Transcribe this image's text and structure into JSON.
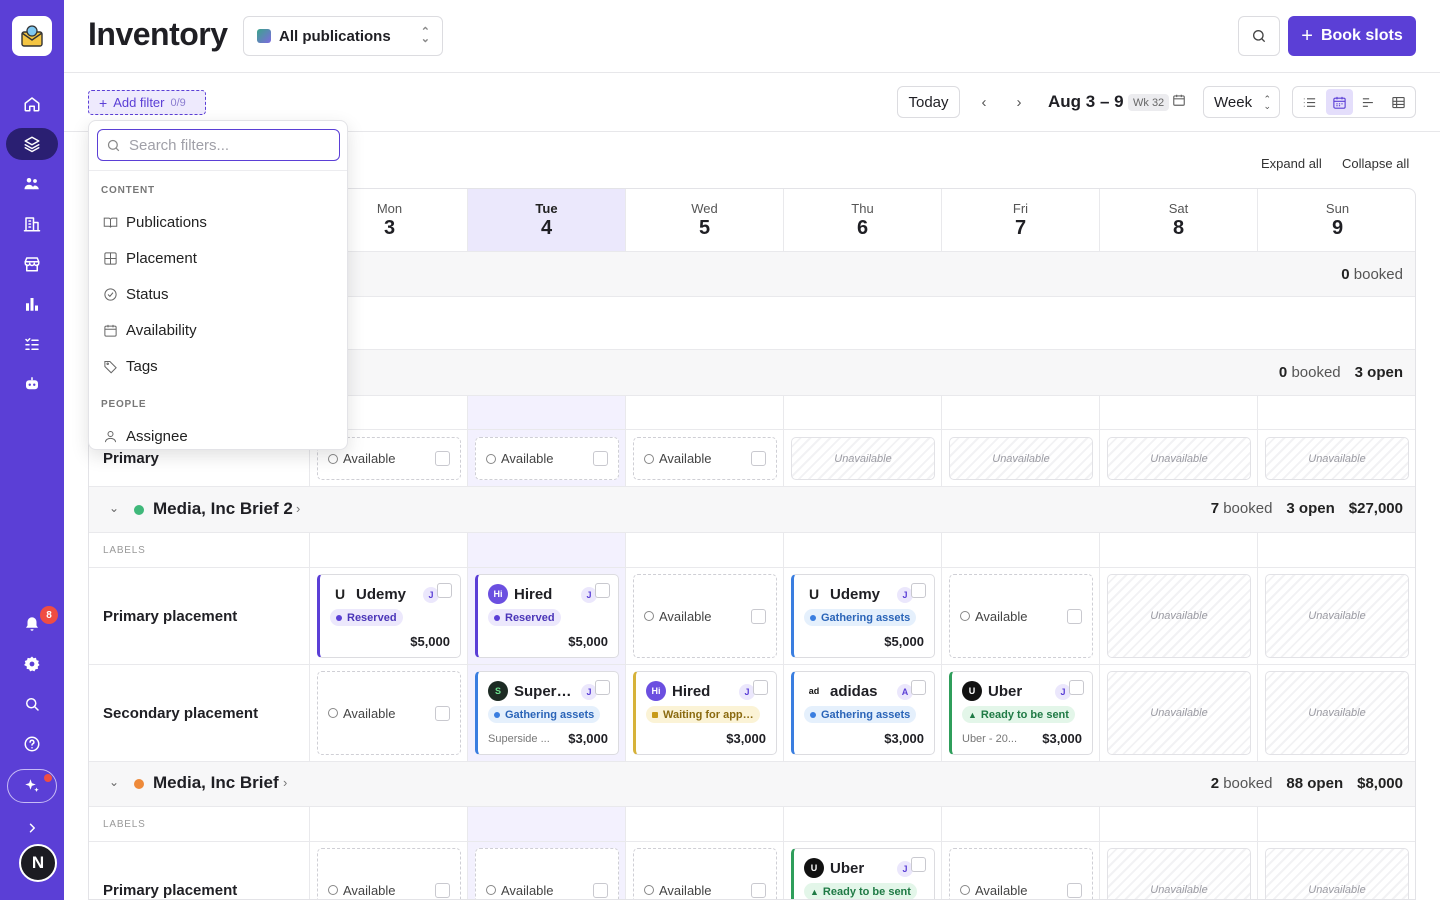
{
  "app": {
    "title": "Inventory",
    "book_label": "Book slots"
  },
  "publication_select": {
    "value": "All publications"
  },
  "toolbar": {
    "add_filter_label": "Add filter",
    "filter_count": "0/9",
    "today_label": "Today",
    "date_range": "Aug 3 – 9",
    "week_badge": "Wk 32",
    "view_mode": "Week",
    "expand_all": "Expand all",
    "collapse_all": "Collapse all"
  },
  "sidebar": {
    "notification_count": "8",
    "avatar_initial": "N",
    "items": [
      "home-icon",
      "layers-icon",
      "audience-icon",
      "buildings-icon",
      "store-icon",
      "chart-icon",
      "tasks-icon",
      "bot-icon"
    ],
    "bottom": [
      "bell-icon",
      "gear-icon",
      "search-icon",
      "help-icon",
      "sparkle-icon",
      "expand-icon"
    ]
  },
  "days": [
    {
      "name": "Mon",
      "date": "3"
    },
    {
      "name": "Tue",
      "date": "4",
      "today": true
    },
    {
      "name": "Wed",
      "date": "5"
    },
    {
      "name": "Thu",
      "date": "6"
    },
    {
      "name": "Fri",
      "date": "7"
    },
    {
      "name": "Sat",
      "date": "8"
    },
    {
      "name": "Sun",
      "date": "9"
    }
  ],
  "filter_popover": {
    "search_placeholder": "Search filters...",
    "sections": [
      {
        "title": "CONTENT",
        "items": [
          {
            "label": "Publications",
            "icon": "book-icon"
          },
          {
            "label": "Placement",
            "icon": "grid-icon"
          },
          {
            "label": "Status",
            "icon": "check-circle-icon"
          },
          {
            "label": "Availability",
            "icon": "calendar-icon"
          },
          {
            "label": "Tags",
            "icon": "tag-icon"
          }
        ]
      },
      {
        "title": "PEOPLE",
        "items": [
          {
            "label": "Assignee",
            "icon": "person-icon"
          }
        ]
      }
    ]
  },
  "group0": {
    "booked_count": "0",
    "booked_word": "booked"
  },
  "group1": {
    "booked_count": "0",
    "booked_word": "booked",
    "open": "3 open",
    "row_label": "Primary"
  },
  "group2": {
    "name": "Media, Inc Brief 2",
    "booked_count": "7",
    "booked_word": "booked",
    "open": "3 open",
    "total": "$27,000",
    "color": "#3fb87a"
  },
  "group3": {
    "name": "Media, Inc Brief",
    "booked_count": "2",
    "booked_word": "booked",
    "open": "88 open",
    "total": "$8,000",
    "color": "#ee8a3a"
  },
  "labels_text": "LABELS",
  "available_text": "Available",
  "unavailable_text": "Unavailable",
  "rows": {
    "g2_primary": "Primary placement",
    "g2_secondary": "Secondary placement",
    "g3_primary": "Primary placement"
  },
  "bookings": {
    "g2p_mon": {
      "name": "Udemy",
      "assignee": "J",
      "status": "Reserved",
      "price": "$5,000",
      "logo": "U"
    },
    "g2p_tue": {
      "name": "Hired",
      "assignee": "J",
      "status": "Reserved",
      "price": "$5,000",
      "logo": "Hi"
    },
    "g2p_thu": {
      "name": "Udemy",
      "assignee": "J",
      "status": "Gathering assets",
      "price": "$5,000",
      "logo": "U"
    },
    "g2s_tue": {
      "name": "Super…",
      "assignee": "J",
      "status": "Gathering assets",
      "price": "$3,000",
      "note": "Superside ...",
      "logo": "S"
    },
    "g2s_wed": {
      "name": "Hired",
      "assignee": "J",
      "status": "Waiting for app…",
      "price": "$3,000",
      "logo": "Hi"
    },
    "g2s_thu": {
      "name": "adidas",
      "assignee": "A",
      "status": "Gathering assets",
      "price": "$3,000",
      "logo": "ad"
    },
    "g2s_fri": {
      "name": "Uber",
      "assignee": "J",
      "status": "Ready to be sent",
      "price": "$3,000",
      "note": "Uber - 20...",
      "logo": "U"
    },
    "g3p_thu": {
      "name": "Uber",
      "assignee": "J",
      "status": "Ready to be sent",
      "logo": "U"
    }
  }
}
